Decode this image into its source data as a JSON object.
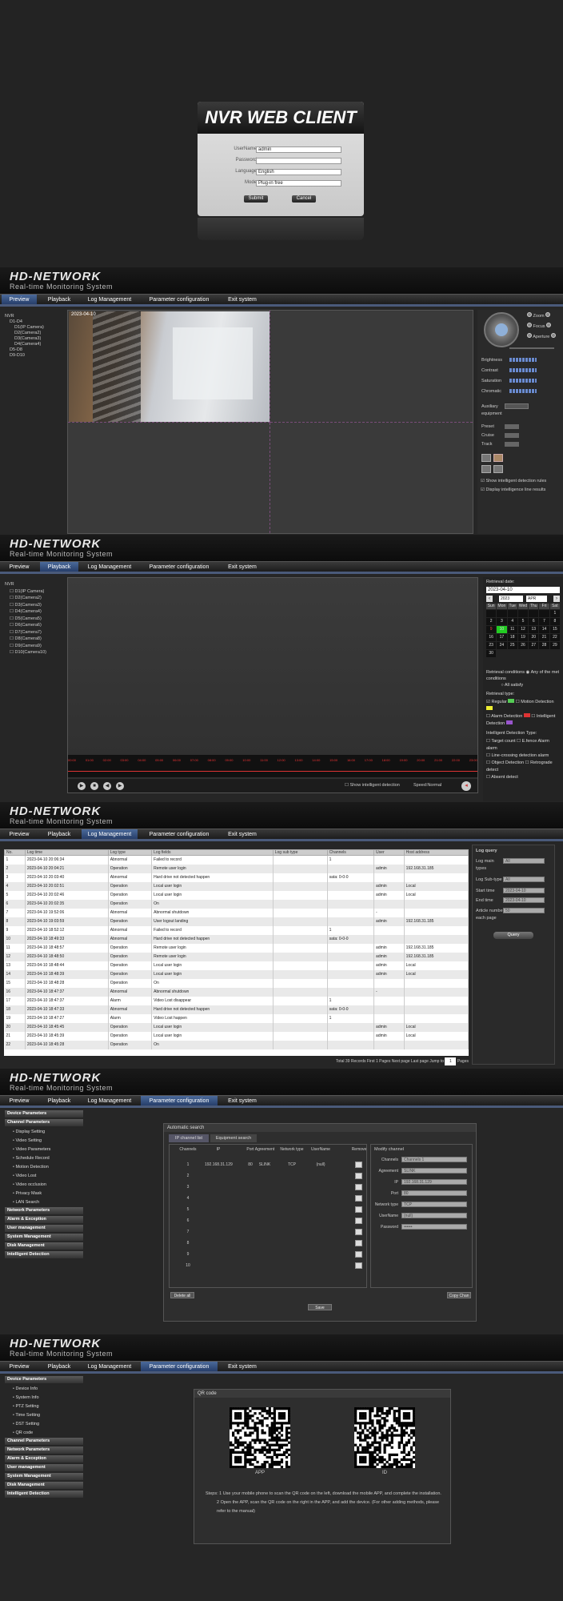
{
  "login": {
    "title": "NVR WEB CLIENT",
    "username_label": "UserName",
    "username_value": "admin",
    "password_label": "Password",
    "language_label": "Language",
    "language_value": "English",
    "mode_label": "Mode",
    "mode_value": "Plug-in free",
    "submit_label": "Submit",
    "cancel_label": "Cancel"
  },
  "brand": {
    "logo": "HD-NETWORK",
    "tagline": "Real-time Monitoring System"
  },
  "nav": [
    "Preview",
    "Playback",
    "Log Management",
    "Parameter configuration",
    "Exit system"
  ],
  "preview": {
    "tree": [
      "NVR",
      "D1-D4",
      "D1(IP Camera)",
      "D2(Camera2)",
      "D3(Camera3)",
      "D4(Camera4)",
      "D5-D8",
      "D9-D10"
    ],
    "timestamp": "2023-04-10",
    "ptz": [
      "Zoom",
      "Focus",
      "Aperture"
    ],
    "image": [
      "Brightness",
      "Contrast",
      "Saturation",
      "Chromatic"
    ],
    "auxiliary_label": "Auxiliary equipment",
    "preset": [
      "Preset",
      "Cruise",
      "Track"
    ],
    "checks": [
      "Show intelligent detection rules",
      "Display intelligence line results"
    ]
  },
  "playback": {
    "tree": [
      "NVR",
      "D1(IP Camera)",
      "D2(Camera2)",
      "D3(Camera3)",
      "D4(Camera4)",
      "D5(Camera5)",
      "D6(Camera6)",
      "D7(Camera7)",
      "D8(Camera8)",
      "D9(Camera9)",
      "D10(Camera10)"
    ],
    "retrieval_date_label": "Retrieval date:",
    "retrieval_date": "2023-04-10",
    "year": "2023",
    "month": "APR",
    "weekdays": [
      "Sun",
      "Mon",
      "Tue",
      "Wed",
      "Thu",
      "Fri",
      "Sat"
    ],
    "days": [
      "",
      "",
      "",
      "",
      "",
      "",
      "1",
      "2",
      "3",
      "4",
      "5",
      "6",
      "7",
      "8",
      "9",
      "10",
      "11",
      "12",
      "13",
      "14",
      "15",
      "16",
      "17",
      "18",
      "19",
      "20",
      "21",
      "22",
      "23",
      "24",
      "25",
      "26",
      "27",
      "28",
      "29",
      "30"
    ],
    "condition_label": "Retrieval conditions",
    "cond_any": "Any of the met conditions",
    "cond_all": "All satisfy",
    "type_label": "Retrieval type:",
    "types": [
      "Regular",
      "Motion Detection",
      "Alarm Detection",
      "Intelligent Detection"
    ],
    "intel_label": "Intelligent Detection Type:",
    "intel_types": [
      "Target count",
      "E.fence Alarm alarm",
      "Line-crossing detection alarm",
      "Object Detection",
      "Retrograde detect",
      "Absent detect"
    ],
    "time_ticks": [
      "00:00",
      "01:00",
      "02:00",
      "03:00",
      "04:00",
      "05:00",
      "06:00",
      "07:00",
      "08:00",
      "09:00",
      "10:00",
      "11:00",
      "12:00",
      "13:00",
      "14:00",
      "15:00",
      "16:00",
      "17:00",
      "18:00",
      "19:00",
      "20:00",
      "21:00",
      "22:00",
      "23:00"
    ],
    "show_intel": "Show intelligent detection",
    "speed": "Speed:Normal"
  },
  "log": {
    "columns": [
      "No.",
      "Log time",
      "Log type",
      "Log fields",
      "Log sub type",
      "Channels",
      "User",
      "Host address"
    ],
    "rows": [
      [
        "1",
        "2023-04-10 20:06:34",
        "Abnormal",
        "Failed to record",
        "",
        "1",
        "",
        ""
      ],
      [
        "2",
        "2023-04-10 20:04:21",
        "Operation",
        "Remote user login",
        "",
        "",
        "admin",
        "192.168.31.185"
      ],
      [
        "3",
        "2023-04-10 20:03:40",
        "Abnormal",
        "Hard drive not detected happen",
        "",
        "sata: 0-0-0",
        "",
        ""
      ],
      [
        "4",
        "2023-04-10 20:02:51",
        "Operation",
        "Local user login",
        "",
        "",
        "admin",
        "Local"
      ],
      [
        "5",
        "2023-04-10 20:02:46",
        "Operation",
        "Local user login",
        "",
        "",
        "admin",
        "Local"
      ],
      [
        "6",
        "2023-04-10 20:02:35",
        "Operation",
        "On",
        "",
        "",
        "",
        ""
      ],
      [
        "7",
        "2023-04-10 19:52:06",
        "Abnormal",
        "Abnormal shutdown",
        "",
        "",
        "-",
        ""
      ],
      [
        "8",
        "2023-04-10 19:03:59",
        "Operation",
        "User logout landing",
        "",
        "",
        "admin",
        "192.168.31.185"
      ],
      [
        "9",
        "2023-04-10 18:52:12",
        "Abnormal",
        "Failed to record",
        "",
        "1",
        "",
        ""
      ],
      [
        "10",
        "2023-04-10 18:49:33",
        "Abnormal",
        "Hard drive not detected happen",
        "",
        "sata: 0-0-0",
        "",
        ""
      ],
      [
        "11",
        "2023-04-10 18:48:57",
        "Operation",
        "Remote user login",
        "",
        "",
        "admin",
        "192.168.31.185"
      ],
      [
        "12",
        "2023-04-10 18:48:50",
        "Operation",
        "Remote user login",
        "",
        "",
        "admin",
        "192.168.31.185"
      ],
      [
        "13",
        "2023-04-10 18:48:44",
        "Operation",
        "Local user login",
        "",
        "",
        "admin",
        "Local"
      ],
      [
        "14",
        "2023-04-10 18:48:39",
        "Operation",
        "Local user login",
        "",
        "",
        "admin",
        "Local"
      ],
      [
        "15",
        "2023-04-10 18:48:28",
        "Operation",
        "On",
        "",
        "",
        "",
        ""
      ],
      [
        "16",
        "2023-04-10 18:47:37",
        "Abnormal",
        "Abnormal shutdown",
        "",
        "",
        "-",
        ""
      ],
      [
        "17",
        "2023-04-10 18:47:37",
        "Alarm",
        "Video Lost disappear",
        "",
        "1",
        "",
        ""
      ],
      [
        "18",
        "2023-04-10 18:47:33",
        "Abnormal",
        "Hard drive not detected happen",
        "",
        "sata: 0-0-0",
        "",
        ""
      ],
      [
        "19",
        "2023-04-10 18:47:27",
        "Alarm",
        "Video Lost happen",
        "",
        "1",
        "",
        ""
      ],
      [
        "20",
        "2023-04-10 18:45:45",
        "Operation",
        "Local user login",
        "",
        "",
        "admin",
        "Local"
      ],
      [
        "21",
        "2023-04-10 18:45:39",
        "Operation",
        "Local user login",
        "",
        "",
        "admin",
        "Local"
      ],
      [
        "22",
        "2023-04-10 18:45:28",
        "Operation",
        "On",
        "",
        "",
        "",
        ""
      ]
    ],
    "footer": "Total 39 Records  First 1 Pages  Next page  Last page  Jump to",
    "footer_page": "1",
    "footer_suffix": "Pages",
    "query_title": "Log query",
    "main_types_label": "Log main types",
    "main_types_value": "All",
    "sub_type_label": "Log Sub-type",
    "sub_type_value": "All",
    "start_label": "Start time",
    "start_value": "2023-04-10",
    "end_label": "End time",
    "end_value": "2023-04-10",
    "article_label": "Article number each page",
    "article_value": "50",
    "query_button": "Query"
  },
  "param": {
    "groups_top": [
      "Device Parameters",
      "Channel Parameters"
    ],
    "channel_items": [
      "Display Setting",
      "Video Setting",
      "Video Parameters",
      "Schedule Record",
      "Motion Detection",
      "Video Lost",
      "Video occlusion",
      "Privacy Mask",
      "LAN Search"
    ],
    "groups_bottom": [
      "Network Parameters",
      "Alarm & Exception",
      "User management",
      "System Management",
      "Disk Management",
      "Intelligent Detection"
    ],
    "box_title": "Automatic search",
    "tab_ip": "IP channel list",
    "tab_equipment": "Equipment search",
    "columns": [
      "Channels",
      "IP",
      "Port",
      "Agreement",
      "Network type",
      "UserName",
      "Remove"
    ],
    "row1": [
      "1",
      "192.168.31.129",
      "80",
      "SLINK",
      "TCP",
      "(null)"
    ],
    "channels": [
      "2",
      "3",
      "4",
      "5",
      "6",
      "7",
      "8",
      "9",
      "10"
    ],
    "modify_title": "Modify channel",
    "modify_fields": [
      "Channels",
      "Agreement",
      "IP",
      "Port",
      "Network type",
      "UserName",
      "Password"
    ],
    "modify_values": [
      "Channels 1",
      "SLINK",
      "192.168.31.129",
      "80",
      "TCP",
      "(null)",
      "••••••"
    ],
    "delete_all": "Delete all",
    "copy_chan": "Copy Chan",
    "save": "Save"
  },
  "qr": {
    "device_items": [
      "Device Info",
      "System Info",
      "PTZ Setting",
      "Time Setting",
      "DST Setting",
      "QR code"
    ],
    "groups_bottom": [
      "Channel Parameters",
      "Network Parameters",
      "Alarm & Exception",
      "User management",
      "System Management",
      "Disk Management",
      "Intelligent Detection"
    ],
    "box_title": "QR code",
    "app_label": "APP",
    "id_label": "ID",
    "steps": [
      "Steps: 1 Use your mobile phone to scan the QR code on the left, download the mobile APP, and complete the installation.",
      "2 Open the APP, scan the QR code on the right in the APP, and add the device. (For other adding methods, please refer to the manual)"
    ]
  }
}
